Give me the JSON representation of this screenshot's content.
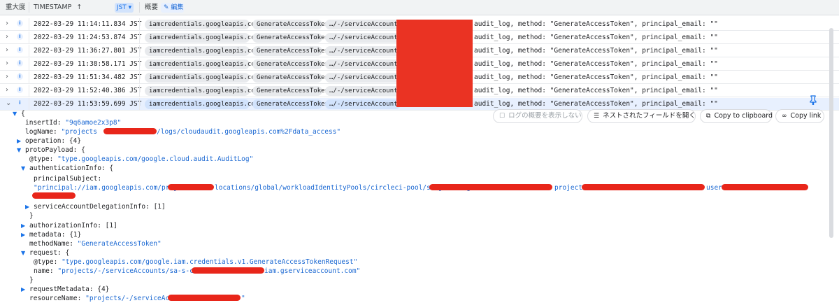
{
  "header": {
    "severity": "重大度",
    "timestamp": "TIMESTAMP",
    "sort_icon": "↑",
    "timezone": "JST",
    "summary": "概要",
    "edit": "編集"
  },
  "rows": [
    {
      "ts": "2022-03-29 11:14:11.834 JST",
      "service": "iamcredentials.googleapis.com",
      "method": "GenerateAccessToken",
      "resource": "…/-/serviceAccounts/",
      "summary": "audit_log, method: \"GenerateAccessToken\", principal_email: \"\""
    },
    {
      "ts": "2022-03-29 11:24:53.874 JST",
      "service": "iamcredentials.googleapis.com",
      "method": "GenerateAccessToken",
      "resource": "…/-/serviceAccounts/",
      "summary": "audit_log, method: \"GenerateAccessToken\", principal_email: \"\""
    },
    {
      "ts": "2022-03-29 11:36:27.801 JST",
      "service": "iamcredentials.googleapis.com",
      "method": "GenerateAccessToken",
      "resource": "…/-/serviceAccounts/",
      "summary": "audit_log, method: \"GenerateAccessToken\", principal_email: \"\""
    },
    {
      "ts": "2022-03-29 11:38:58.171 JST",
      "service": "iamcredentials.googleapis.com",
      "method": "GenerateAccessToken",
      "resource": "…/-/serviceAccounts/",
      "summary": "audit_log, method: \"GenerateAccessToken\", principal_email: \"\""
    },
    {
      "ts": "2022-03-29 11:51:34.482 JST",
      "service": "iamcredentials.googleapis.com",
      "method": "GenerateAccessToken",
      "resource": "…/-/serviceAccounts/",
      "summary": "audit_log, method: \"GenerateAccessToken\", principal_email: \"\""
    },
    {
      "ts": "2022-03-29 11:52:40.386 JST",
      "service": "iamcredentials.googleapis.com",
      "method": "GenerateAccessToken",
      "resource": "…/-/serviceAccounts/",
      "summary": "audit_log, method: \"GenerateAccessToken\", principal_email: \"\""
    },
    {
      "ts": "2022-03-29 11:53:59.699 JST",
      "service": "iamcredentials.googleapis.com",
      "method": "GenerateAccessToken",
      "resource": "…/-/serviceAccounts/",
      "summary": "audit_log, method: \"GenerateAccessToken\", principal_email: \"\""
    }
  ],
  "actions": {
    "hide_summary": "ログの概要を表示しない",
    "open_nested": "ネストされたフィールドを開く",
    "copy_clipboard": "Copy to clipboard",
    "copy_link": "Copy link"
  },
  "json": {
    "open_brace": "{",
    "insertId_key": "insertId:",
    "insertId_val": "\"9q6amoe2x3p8\"",
    "logName_key": "logName:",
    "logName_val_a": "\"projects",
    "logName_val_b": "/logs/cloudaudit.googleapis.com%2Fdata_access\"",
    "operation": "operation: {4}",
    "protoPayload": "protoPayload: {",
    "type_key": "@type:",
    "type_val": "\"type.googleapis.com/google.cloud.audit.AuditLog\"",
    "authInfo": "authenticationInfo: {",
    "principalSubject_key": "principalSubject:",
    "ps_a": "\"principal://iam.googleapis.com/projects/",
    "ps_b": "locations/global/workloadIdentityPools/circleci-pool/subject/org/",
    "ps_c": "project",
    "ps_d": "user",
    "sadi": "serviceAccountDelegationInfo: [1]",
    "close1": "}",
    "authzInfo": "authorizationInfo: [1]",
    "metadata": "metadata: {1}",
    "methodName_key": "methodName:",
    "methodName_val": "\"GenerateAccessToken\"",
    "request": "request: {",
    "req_type_key": "@type:",
    "req_type_val": "\"type.googleapis.com/google.iam.credentials.v1.GenerateAccessTokenRequest\"",
    "name_key": "name:",
    "name_val_a": "\"projects/-/serviceAccounts/sa-s-circleci",
    "name_val_b": "iam.gserviceaccount.com\"",
    "close2": "}",
    "requestMetadata": "requestMetadata: {4}",
    "resourceName_key": "resourceName:",
    "resourceName_val_a": "\"projects/-/serviceAccounts/",
    "resourceName_val_b": "\""
  },
  "colors": {
    "accent": "#1a73e8",
    "redaction": "#ea3323",
    "selected_row": "#e8f0fe"
  }
}
